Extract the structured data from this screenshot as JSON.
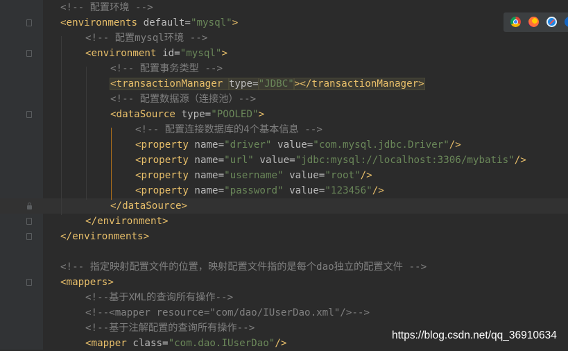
{
  "editor": {
    "lines": [
      {
        "indent": 1,
        "parts": [
          {
            "c": "c",
            "t": "<!-- 配置环境 -->"
          }
        ]
      },
      {
        "indent": 1,
        "parts": [
          {
            "c": "t",
            "t": "<environments "
          },
          {
            "c": "a",
            "t": "default="
          },
          {
            "c": "v",
            "t": "\"mysql\""
          },
          {
            "c": "t",
            "t": ">"
          }
        ]
      },
      {
        "indent": 2,
        "parts": [
          {
            "c": "c",
            "t": "<!-- 配置mysql环境 -->"
          }
        ]
      },
      {
        "indent": 2,
        "parts": [
          {
            "c": "t",
            "t": "<environment "
          },
          {
            "c": "a",
            "t": "id="
          },
          {
            "c": "v",
            "t": "\"mysql\""
          },
          {
            "c": "t",
            "t": ">"
          }
        ]
      },
      {
        "indent": 3,
        "parts": [
          {
            "c": "c",
            "t": "<!-- 配置事务类型 -->"
          }
        ]
      },
      {
        "indent": 3,
        "hl": true,
        "parts": [
          {
            "c": "t",
            "t": "<transactionManager "
          },
          {
            "c": "a",
            "t": "type="
          },
          {
            "c": "v",
            "t": "\"JDBC\""
          },
          {
            "c": "t",
            "t": "></transactionManager>"
          }
        ]
      },
      {
        "indent": 3,
        "parts": [
          {
            "c": "c",
            "t": "<!-- 配置数据源（连接池）-->"
          }
        ]
      },
      {
        "indent": 3,
        "parts": [
          {
            "c": "t",
            "t": "<dataSource "
          },
          {
            "c": "a",
            "t": "type="
          },
          {
            "c": "v",
            "t": "\"POOLED\""
          },
          {
            "c": "t",
            "t": ">"
          }
        ]
      },
      {
        "indent": 4,
        "parts": [
          {
            "c": "c",
            "t": "<!-- 配置连接数据库的4个基本信息 -->"
          }
        ]
      },
      {
        "indent": 4,
        "parts": [
          {
            "c": "t",
            "t": "<property "
          },
          {
            "c": "a",
            "t": "name="
          },
          {
            "c": "v",
            "t": "\"driver\""
          },
          {
            "c": "a",
            "t": " value="
          },
          {
            "c": "v",
            "t": "\"com.mysql.jdbc.Driver\""
          },
          {
            "c": "t",
            "t": "/>"
          }
        ]
      },
      {
        "indent": 4,
        "parts": [
          {
            "c": "t",
            "t": "<property "
          },
          {
            "c": "a",
            "t": "name="
          },
          {
            "c": "v",
            "t": "\"url\""
          },
          {
            "c": "a",
            "t": " value="
          },
          {
            "c": "v",
            "t": "\"jdbc:mysql://localhost:3306/mybatis\""
          },
          {
            "c": "t",
            "t": "/>"
          }
        ]
      },
      {
        "indent": 4,
        "parts": [
          {
            "c": "t",
            "t": "<property "
          },
          {
            "c": "a",
            "t": "name="
          },
          {
            "c": "v",
            "t": "\"username\""
          },
          {
            "c": "a",
            "t": " value="
          },
          {
            "c": "v",
            "t": "\"root\""
          },
          {
            "c": "t",
            "t": "/>"
          }
        ]
      },
      {
        "indent": 4,
        "parts": [
          {
            "c": "t",
            "t": "<property "
          },
          {
            "c": "a",
            "t": "name="
          },
          {
            "c": "v",
            "t": "\"password\""
          },
          {
            "c": "a",
            "t": " value="
          },
          {
            "c": "v",
            "t": "\"123456\""
          },
          {
            "c": "t",
            "t": "/>"
          }
        ]
      },
      {
        "indent": 3,
        "current": true,
        "parts": [
          {
            "c": "t",
            "t": "</dataSource>"
          }
        ]
      },
      {
        "indent": 2,
        "parts": [
          {
            "c": "t",
            "t": "</environment>"
          }
        ]
      },
      {
        "indent": 1,
        "parts": [
          {
            "c": "t",
            "t": "</environments>"
          }
        ]
      },
      {
        "indent": 0,
        "parts": []
      },
      {
        "indent": 1,
        "parts": [
          {
            "c": "c",
            "t": "<!-- 指定映射配置文件的位置，映射配置文件指的是每个dao独立的配置文件 -->"
          }
        ]
      },
      {
        "indent": 1,
        "parts": [
          {
            "c": "t",
            "t": "<mappers>"
          }
        ]
      },
      {
        "indent": 2,
        "parts": [
          {
            "c": "c",
            "t": "<!--基于XML的查询所有操作-->"
          }
        ]
      },
      {
        "indent": 2,
        "parts": [
          {
            "c": "c",
            "t": "<!--<mapper resource=\"com/dao/IUserDao.xml\"/>-->"
          }
        ]
      },
      {
        "indent": 2,
        "parts": [
          {
            "c": "c",
            "t": "<!--基于注解配置的查询所有操作-->"
          }
        ]
      },
      {
        "indent": 2,
        "parts": [
          {
            "c": "t",
            "t": "<mapper "
          },
          {
            "c": "a",
            "t": "class="
          },
          {
            "c": "v",
            "t": "\"com.dao.IUserDao\""
          },
          {
            "c": "t",
            "t": "/>"
          }
        ]
      }
    ],
    "fold_markers": [
      "",
      "fold",
      "",
      "fold",
      "",
      "",
      "",
      "fold",
      "",
      "",
      "",
      "",
      "",
      "lock",
      "fold",
      "fold",
      "",
      "",
      "fold",
      "",
      "",
      "",
      ""
    ]
  },
  "browser_icons": [
    "chrome-icon",
    "firefox-icon",
    "safari-icon",
    "edge-icon"
  ],
  "watermark": "https://blog.csdn.net/qq_36910634",
  "colors": {
    "background": "#2b2b2b",
    "tag": "#e8bf6a",
    "attribute": "#bababa",
    "value": "#6a8759",
    "comment": "#808080",
    "guide": "#b0701a"
  }
}
